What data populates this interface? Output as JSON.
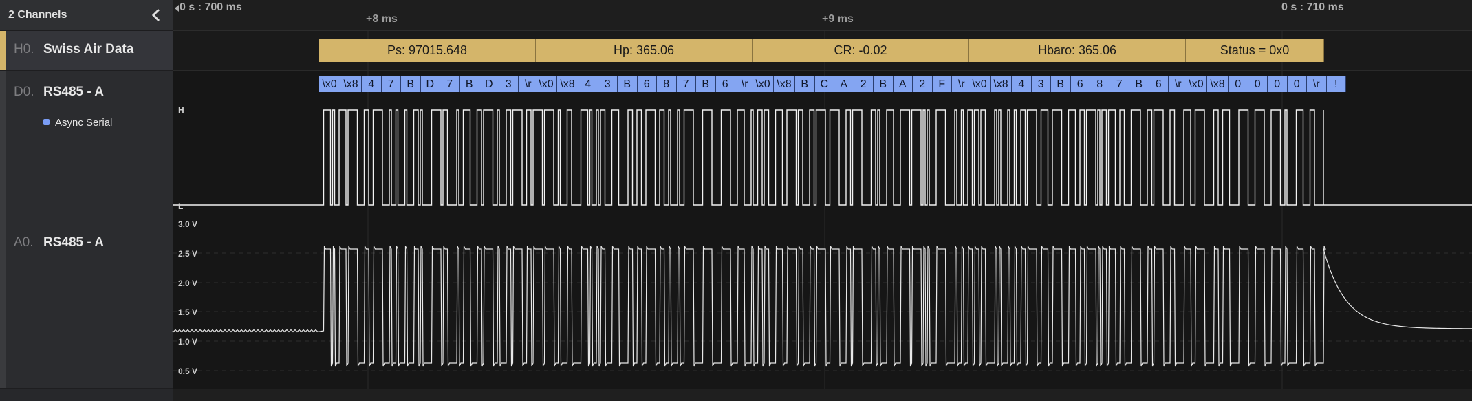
{
  "sidebar": {
    "title": "2 Channels",
    "channels": [
      {
        "id": "H0.",
        "name": "Swiss Air Data",
        "accent": "#d4b56a"
      },
      {
        "id": "D0.",
        "name": "RS485 - A",
        "accent": "#3a3b3e",
        "analyzer": "Async Serial"
      },
      {
        "id": "A0.",
        "name": "RS485 - A",
        "accent": "#3a3b3e"
      }
    ]
  },
  "ruler": {
    "start": "0 s : 700 ms",
    "mark1": "+8 ms",
    "mark2": "+9 ms",
    "end": "0 s : 710 ms"
  },
  "frames": [
    "Ps: 97015.648",
    "Hp: 365.06",
    "CR: -0.02",
    "Hbaro: 365.06",
    "Status = 0x0"
  ],
  "bytes": [
    [
      "\\x0",
      "\\x8",
      "4",
      "7",
      "B",
      "D",
      "7",
      "B",
      "D",
      "3",
      "\\r"
    ],
    [
      "\\x0",
      "\\x8",
      "4",
      "3",
      "B",
      "6",
      "8",
      "7",
      "B",
      "6",
      "\\r"
    ],
    [
      "\\x0",
      "\\x8",
      "B",
      "C",
      "A",
      "2",
      "B",
      "A",
      "2",
      "F",
      "\\r"
    ],
    [
      "\\x0",
      "\\x8",
      "4",
      "3",
      "B",
      "6",
      "8",
      "7",
      "B",
      "6",
      "\\r"
    ],
    [
      "\\x0",
      "\\x8",
      "0",
      "0",
      "0",
      "0",
      "\\r",
      "!"
    ]
  ],
  "digital": {
    "high_label": "H",
    "low_label": "L"
  },
  "analog": {
    "labels": [
      "3.0 V",
      "2.5 V",
      "2.0 V",
      "1.5 V",
      "1.0 V",
      "0.5 V"
    ]
  },
  "colors": {
    "hla": "#d4b56a",
    "serial": "#84a5f2",
    "trace": "#e8e8e8"
  },
  "icons": {
    "collapse": "chevron-left-icon"
  }
}
